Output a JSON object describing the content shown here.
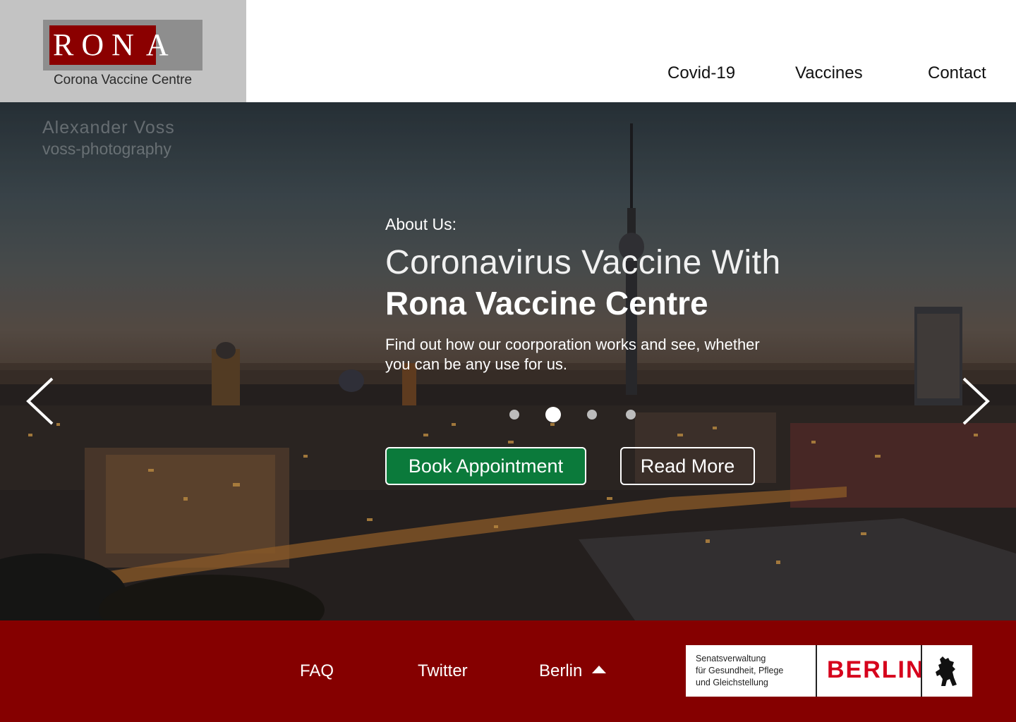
{
  "brand": {
    "logo_letters_boxed": "RON",
    "logo_letter_last": "A",
    "tagline": "Corona Vaccine Centre"
  },
  "nav": {
    "items": [
      {
        "label": "Covid-19"
      },
      {
        "label": "Vaccines"
      },
      {
        "label": "Contact"
      }
    ]
  },
  "hero": {
    "watermark_name": "Alexander Voss",
    "watermark_site": "voss-photography",
    "about": "About Us:",
    "title_light": "Coronavirus Vaccine With",
    "title_bold": "Rona Vaccine Centre",
    "subtitle": "Find out how our coorporation works and see, whether you can be any use for us.",
    "carousel": {
      "slide_count": 4,
      "active_index": 1
    },
    "book_label": "Book Appointment",
    "read_more_label": "Read More",
    "book_color": "#0b7a3b"
  },
  "footer": {
    "links": [
      {
        "label": "FAQ"
      },
      {
        "label": "Twitter"
      },
      {
        "label": "Berlin"
      }
    ],
    "badge": {
      "line1": "Senatsverwaltung",
      "line2": "für Gesundheit, Pflege",
      "line3": "und Gleichstellung",
      "word": "BERLIN"
    },
    "background": "#850000"
  }
}
